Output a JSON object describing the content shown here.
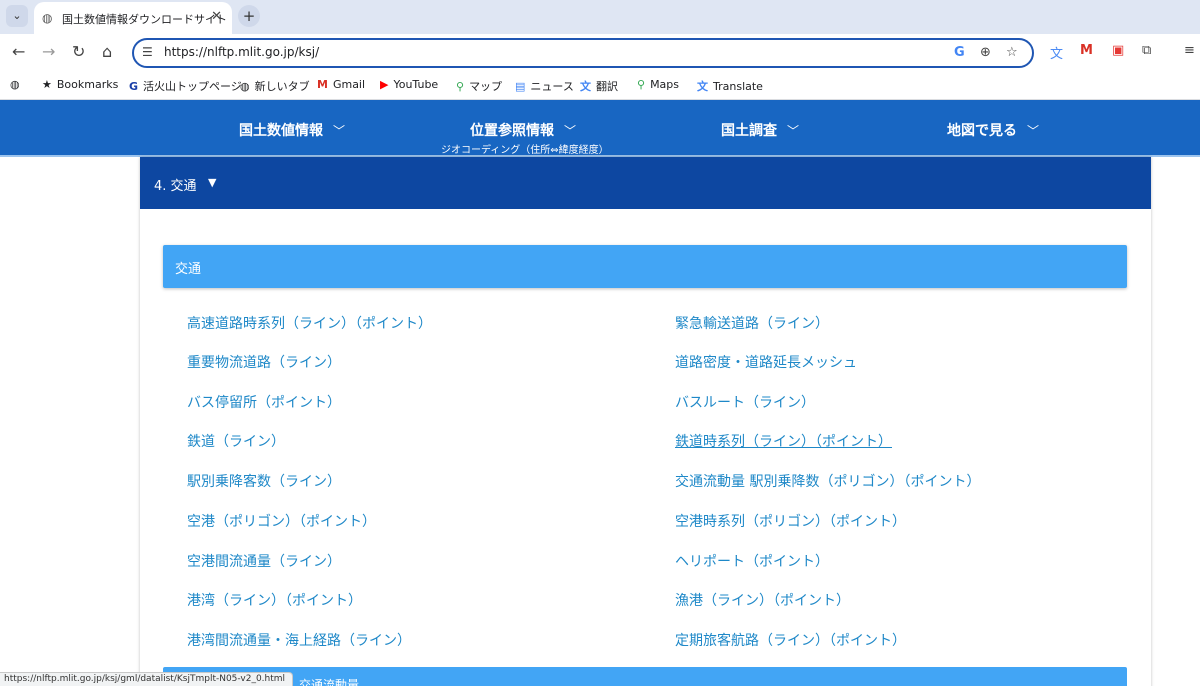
{
  "browser": {
    "tab": {
      "title": "国土数値情報ダウンロードサイト",
      "favicon": "globe-icon",
      "close": "✕"
    },
    "new_tab": "+",
    "omnibox": {
      "url": "https://nlftp.mlit.go.jp/ksj/"
    },
    "bookmarks": [
      {
        "label": "Bookmarks",
        "icon": "star-icon"
      },
      {
        "label": "活火山トップページ",
        "icon": "g-icon"
      },
      {
        "label": "新しいタブ",
        "icon": "globe-icon"
      },
      {
        "label": "Gmail",
        "icon": "gmail-icon"
      },
      {
        "label": "YouTube",
        "icon": "youtube-icon"
      },
      {
        "label": "マップ",
        "icon": "maps-pin-icon"
      },
      {
        "label": "ニュース",
        "icon": "news-icon"
      },
      {
        "label": "翻訳",
        "icon": "translate-icon"
      },
      {
        "label": "Maps",
        "icon": "maps-pin-icon"
      },
      {
        "label": "Translate",
        "icon": "translate-icon"
      }
    ],
    "status_url": "https://nlftp.mlit.go.jp/ksj/gml/datalist/KsjTmplt-N05-v2_0.html"
  },
  "site_nav": {
    "items": [
      {
        "label": "国土数値情報"
      },
      {
        "label": "位置参照情報",
        "sub": "ジオコーディング（住所⇔緯度経度）"
      },
      {
        "label": "国土調査"
      },
      {
        "label": "地図で見る"
      }
    ]
  },
  "section": {
    "title": "4. 交通"
  },
  "card": {
    "title": "交通",
    "links_left": [
      "高速道路時系列（ライン）（ポイント）",
      "重要物流道路（ライン）",
      "バス停留所（ポイント）",
      "鉄道（ライン）",
      "駅別乗降客数（ライン）",
      "空港（ポリゴン）（ポイント）",
      "空港間流通量（ライン）",
      "港湾（ライン）（ポイント）",
      "港湾間流通量・海上経路（ライン）"
    ],
    "links_right": [
      "緊急輸送道路（ライン）",
      "道路密度・道路延長メッシュ",
      "バスルート（ライン）",
      "鉄道時系列（ライン）（ポイント）",
      "交通流動量 駅別乗降数（ポリゴン）（ポイント）",
      "空港時系列（ポリゴン）（ポイント）",
      "ヘリポート（ポイント）",
      "漁港（ライン）（ポイント）",
      "定期旅客航路（ライン）（ポイント）"
    ]
  },
  "next_card": {
    "title": "交通流動量"
  },
  "colors": {
    "nav": "#1866c2",
    "section": "#0d47a1",
    "card": "#42a5f5",
    "link": "#1e88c8"
  }
}
